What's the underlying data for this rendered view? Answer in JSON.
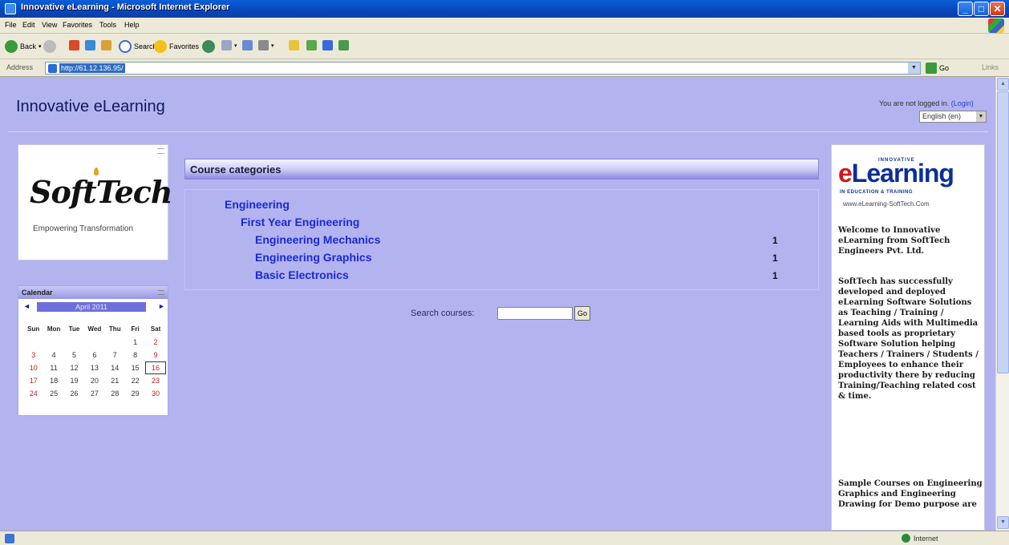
{
  "window": {
    "title": "Innovative eLearning - Microsoft Internet Explorer"
  },
  "menu": [
    "File",
    "Edit",
    "View",
    "Favorites",
    "Tools",
    "Help"
  ],
  "toolbar": {
    "back": "Back",
    "search": "Search",
    "favorites": "Favorites"
  },
  "address": {
    "label": "Address",
    "url": "http://61.12.136.95/",
    "go": "Go",
    "links": "Links"
  },
  "page": {
    "site_title": "Innovative eLearning",
    "login_text": "You are not logged in.",
    "login_link": "(Login)",
    "language": "English (en)",
    "logo_text": "SoftTech",
    "logo_tagline": "Empowering Transformation",
    "calendar": {
      "title": "Calendar",
      "prev": "◄",
      "next": "►",
      "month": "April 2011",
      "weekdays": [
        "Sun",
        "Mon",
        "Tue",
        "Wed",
        "Thu",
        "Fri",
        "Sat"
      ],
      "weeks": [
        [
          "",
          "",
          "",
          "",
          "",
          "1",
          "2"
        ],
        [
          "3",
          "4",
          "5",
          "6",
          "7",
          "8",
          "9"
        ],
        [
          "10",
          "11",
          "12",
          "13",
          "14",
          "15",
          "16"
        ],
        [
          "17",
          "18",
          "19",
          "20",
          "21",
          "22",
          "23"
        ],
        [
          "24",
          "25",
          "26",
          "27",
          "28",
          "29",
          "30"
        ]
      ],
      "today": "16"
    },
    "categories": {
      "heading": "Course categories",
      "top": "Engineering",
      "sub": "First Year Engineering",
      "courses": [
        {
          "name": "Engineering Mechanics",
          "count": "1"
        },
        {
          "name": "Engineering Graphics",
          "count": "1"
        },
        {
          "name": "Basic Electronics",
          "count": "1"
        }
      ]
    },
    "search": {
      "label": "Search courses:",
      "value": "",
      "button": "Go"
    },
    "elearning": {
      "innovative": "INNOVATIVE",
      "brand_e": "e",
      "brand_rest": "Learning",
      "subtitle": "IN EDUCATION & TRAINING",
      "url": "www.eLearning-SoftTech.Com",
      "para1": "Welcome to Innovative eLearning from SoftTech Engineers Pvt. Ltd.",
      "para2": "SoftTech has successfully developed and deployed eLearning Software Solutions as Teaching / Training / Learning Aids with Multimedia based tools as proprietary Software Solution helping Teachers / Trainers / Students / Employees to enhance their productivity there by reducing Training/Teaching related cost & time.",
      "para3": "Sample Courses on Engineering Graphics and Engineering Drawing for Demo purpose are"
    }
  },
  "status": {
    "zone": "Internet"
  },
  "colors": {
    "page_bg": "#b3b3f0",
    "link": "#1a2ad4",
    "title_bar": "#0a5fd8"
  }
}
